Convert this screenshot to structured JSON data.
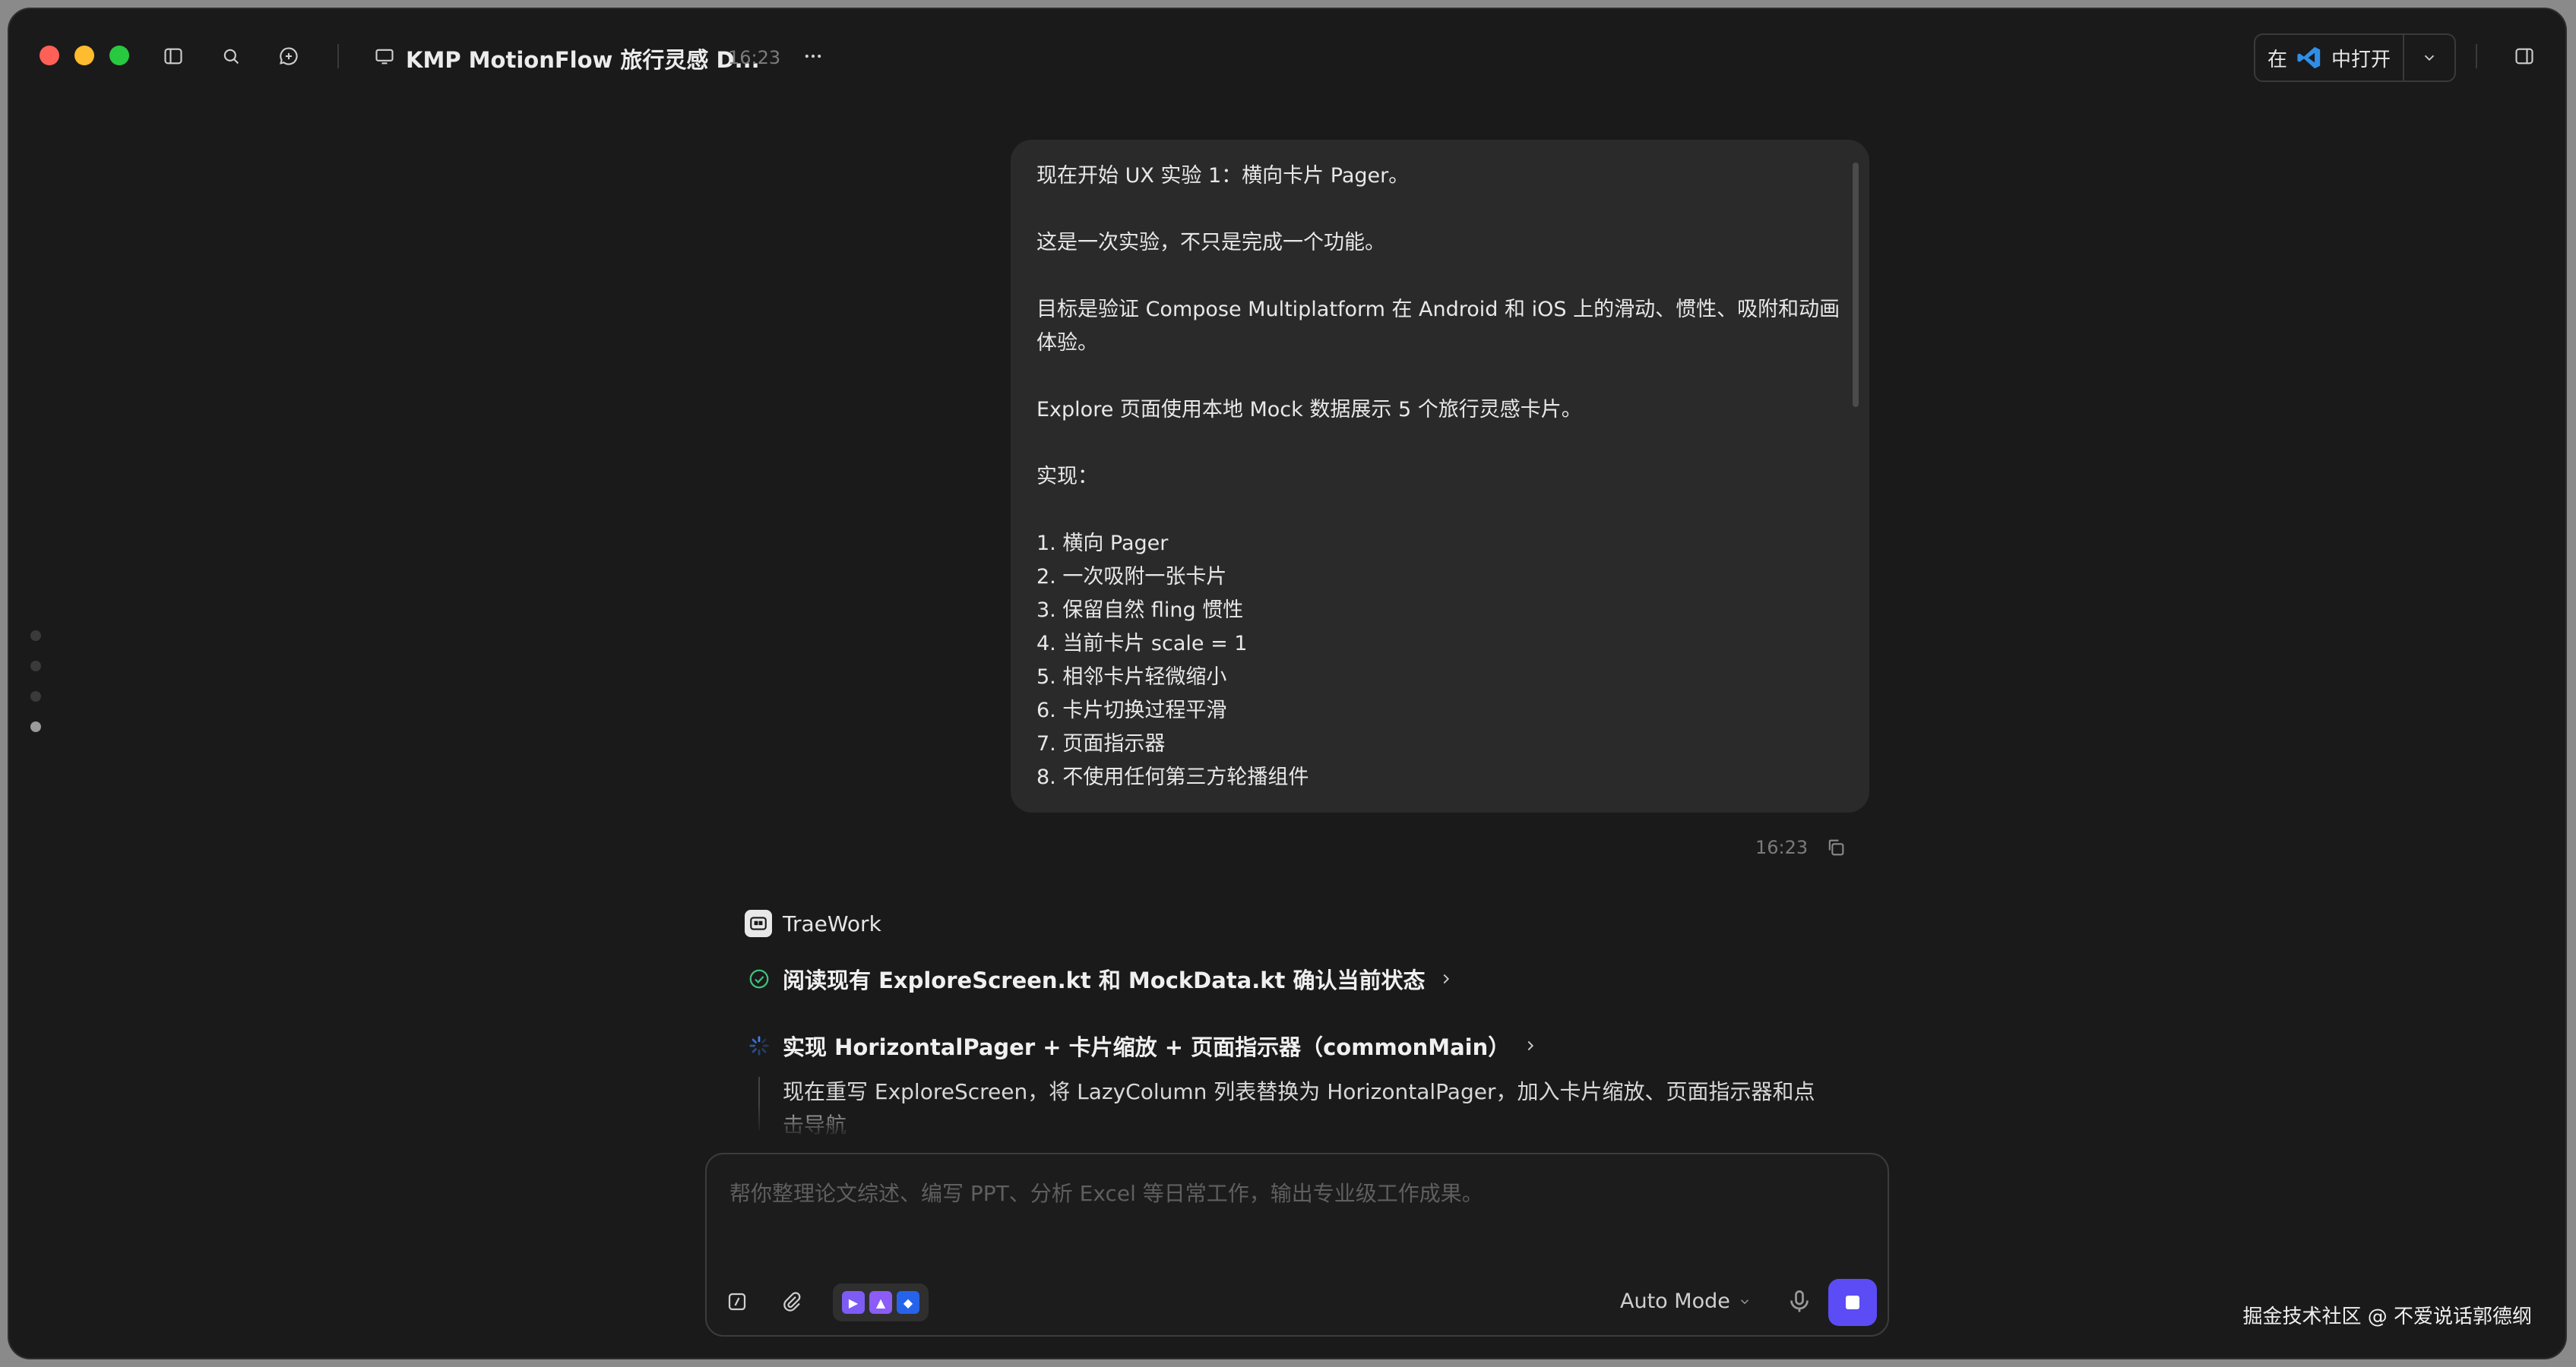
{
  "window": {
    "title": "KMP MotionFlow 旅行灵感 D...",
    "time": "16:23",
    "open_in": {
      "prefix": "在",
      "suffix": "中打开",
      "app_icon": "vscode-icon"
    }
  },
  "message": {
    "lines": [
      "现在开始 UX 实验 1：横向卡片 Pager。",
      "",
      "这是一次实验，不只是完成一个功能。",
      "",
      "目标是验证 Compose Multiplatform 在 Android 和 iOS 上的滑动、惯性、吸附和动画体验。",
      "",
      "Explore 页面使用本地 Mock 数据展示 5 个旅行灵感卡片。",
      "",
      "实现：",
      "",
      "1. 横向 Pager",
      "2. 一次吸附一张卡片",
      "3. 保留自然 fling 惯性",
      "4. 当前卡片 scale = 1",
      "5. 相邻卡片轻微缩小",
      "6. 卡片切换过程平滑",
      "7. 页面指示器",
      "8. 不使用任何第三方轮播组件"
    ],
    "time": "16:23"
  },
  "agent": {
    "name": "TraeWork",
    "steps": [
      {
        "status": "done",
        "text": "阅读现有 ExploreScreen.kt 和 MockData.kt 确认当前状态"
      },
      {
        "status": "running",
        "text": "实现 HorizontalPager + 卡片缩放 + 页面指示器（commonMain）"
      }
    ],
    "detail": "现在重写 ExploreScreen，将 LazyColumn 列表替换为 HorizontalPager，加入卡片缩放、页面指示器和点击导航"
  },
  "input": {
    "placeholder": "帮你整理论文综述、编写 PPT、分析 Excel 等日常工作，输出专业级工作成果。",
    "mode": "Auto Mode"
  },
  "watermark": "掘金技术社区 @ 不爱说话郭德纲",
  "colors": {
    "accent": "#5b4cf5",
    "success": "#3ec27b",
    "running": "#3b82f6"
  }
}
